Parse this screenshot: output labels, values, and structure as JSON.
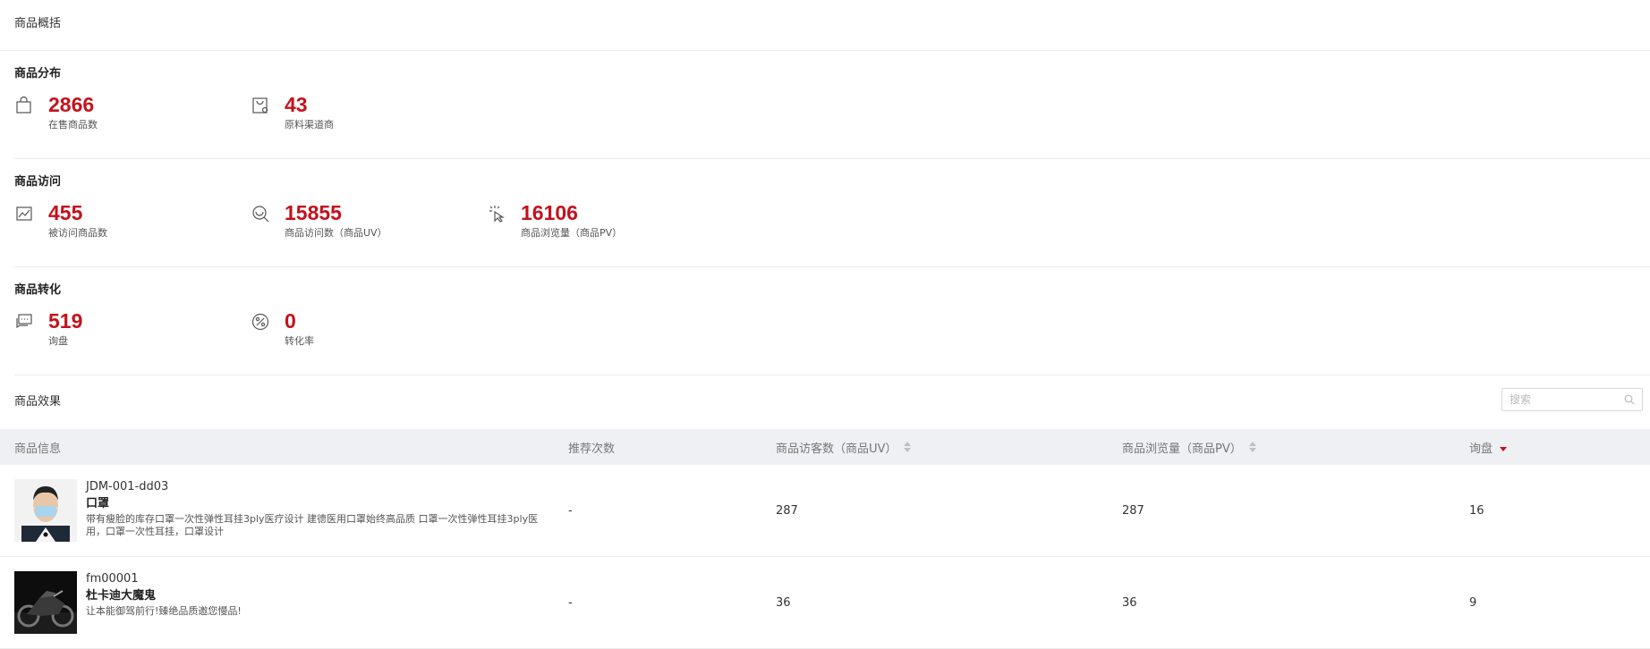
{
  "overview": {
    "title": "商品概括"
  },
  "distribution": {
    "title": "商品分布",
    "metrics": [
      {
        "value": "2866",
        "label": "在售商品数",
        "icon": "shopping-bag-icon"
      },
      {
        "value": "43",
        "label": "原料渠道商",
        "icon": "supplier-bag-icon"
      }
    ]
  },
  "visits": {
    "title": "商品访问",
    "metrics": [
      {
        "value": "455",
        "label": "被访问商品数",
        "icon": "trend-chart-icon"
      },
      {
        "value": "15855",
        "label": "商品访问数（商品UV）",
        "icon": "visitor-search-icon"
      },
      {
        "value": "16106",
        "label": "商品浏览量（商品PV）",
        "icon": "click-icon"
      }
    ]
  },
  "conversion": {
    "title": "商品转化",
    "metrics": [
      {
        "value": "519",
        "label": "询盘",
        "icon": "chat-bubble-icon"
      },
      {
        "value": "0",
        "label": "转化率",
        "icon": "percent-icon"
      }
    ]
  },
  "effect": {
    "title": "商品效果",
    "search_placeholder": "搜索",
    "columns": {
      "info": "商品信息",
      "recommend": "推荐次数",
      "uv": "商品访客数（商品UV）",
      "pv": "商品浏览量（商品PV）",
      "inquiry": "询盘"
    },
    "sort": {
      "column": "inquiry",
      "direction": "descending"
    },
    "rows": [
      {
        "code": "JDM-001-dd03",
        "name": "口罩",
        "desc": "带有瘦脸的库存口罩一次性弹性耳挂3ply医疗设计 建德医用口罩始终高品质 口罩一次性弹性耳挂3ply医用，口罩一次性耳挂，口罩设计",
        "thumb": "man-wearing-face-mask",
        "recommend": "-",
        "uv": "287",
        "pv": "287",
        "inquiry": "16"
      },
      {
        "code": "fm00001",
        "name": "杜卡迪大魔鬼",
        "desc": "让本能御驾前行!臻绝品质邀您慢品!",
        "thumb": "black-motorcycle",
        "recommend": "-",
        "uv": "36",
        "pv": "36",
        "inquiry": "9"
      }
    ]
  },
  "colors": {
    "accent": "#c4121c",
    "header_bg": "#eef0f3",
    "divider": "#ececec"
  }
}
